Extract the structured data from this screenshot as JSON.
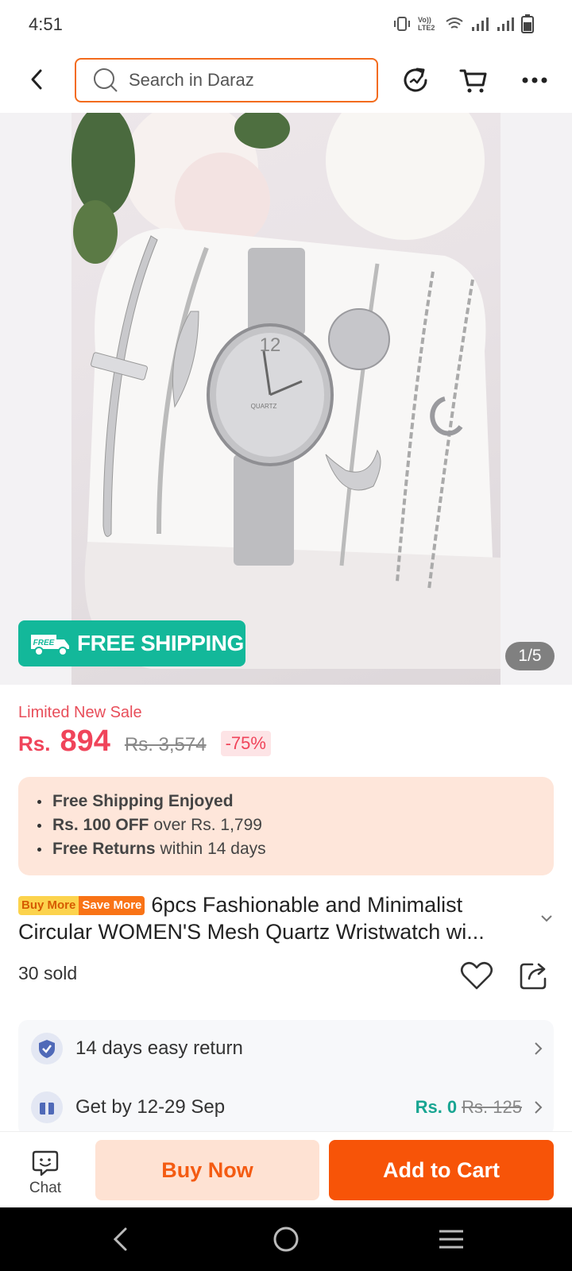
{
  "status_bar": {
    "time": "4:51",
    "network_label": "Vo)) LTE2"
  },
  "header": {
    "search_placeholder": "Search in Daraz",
    "accent_color": "#f36b1c"
  },
  "gallery": {
    "free_shipping_label": "FREE SHIPPING",
    "free_badge_text": "FREE",
    "counter": "1/5",
    "watch_dial_text": "QUARTZ",
    "watch_numeral": "12"
  },
  "pricing": {
    "sale_tag": "Limited New Sale",
    "currency": "Rs.",
    "price": "894",
    "original_price": "Rs. 3,574",
    "discount": "-75%"
  },
  "promos": [
    {
      "bold": "Free Shipping Enjoyed",
      "rest": ""
    },
    {
      "bold": "Rs. 100 OFF",
      "rest": "over Rs. 1,799"
    },
    {
      "bold": "Free Returns",
      "rest": "within 14 days"
    }
  ],
  "product": {
    "badge_buy_more": "Buy More",
    "badge_save_more": "Save More",
    "title_line1": "6pcs Fashionable and Minimalist",
    "title_line2": "Circular WOMEN'S Mesh Quartz Wristwatch wi...",
    "sold": "30 sold"
  },
  "services": {
    "returns": "14 days easy return",
    "delivery": "Get by 12-29 Sep",
    "shipping_fee": "Rs. 0",
    "shipping_fee_original": "Rs. 125"
  },
  "actions": {
    "chat": "Chat",
    "buy_now": "Buy Now",
    "add_to_cart": "Add to Cart"
  }
}
